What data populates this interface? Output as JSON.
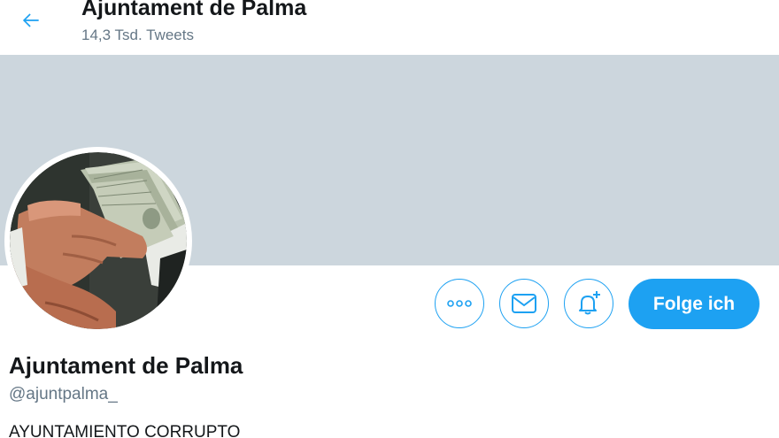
{
  "header": {
    "title": "Ajuntament de Palma",
    "tweet_count": "14,3 Tsd. Tweets",
    "back_icon": "arrow-left-icon"
  },
  "banner": {
    "color": "#ccd6dd"
  },
  "avatar": {
    "image": "handshake-with-money"
  },
  "actions": {
    "more_icon": "more-options-icon",
    "message_icon": "envelope-icon",
    "notify_icon": "bell-plus-icon",
    "follow_label": "Folge ich"
  },
  "profile": {
    "name": "Ajuntament de Palma",
    "handle": "@ajuntpalma_",
    "bio": "AYUNTAMIENTO CORRUPTO"
  },
  "colors": {
    "accent": "#1da1f2",
    "text": "#14171a",
    "secondary_text": "#657786"
  }
}
